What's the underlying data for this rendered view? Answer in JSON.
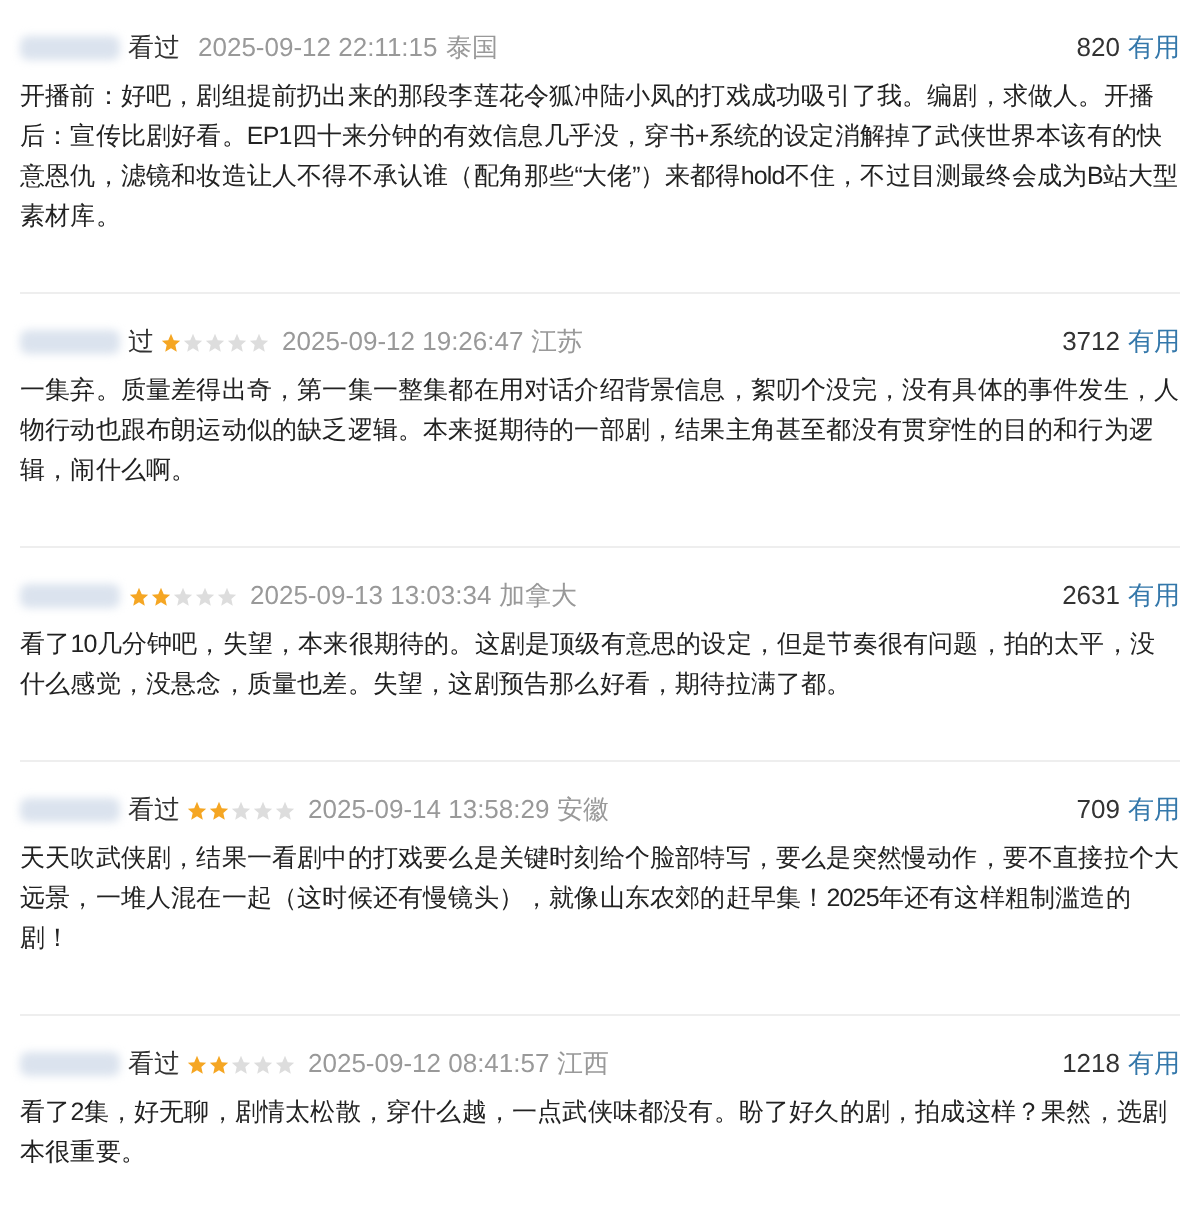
{
  "reviews": [
    {
      "status": "看过",
      "time": "2025-09-12 22:11:15",
      "location": "泰国",
      "votes": "820",
      "vote_label": "有用",
      "text": "开播前：好吧，剧组提前扔出来的那段李莲花令狐冲陆小凤的打戏成功吸引了我。编剧，求做人。开播后：宣传比剧好看。EP1四十来分钟的有效信息几乎没，穿书+系统的设定消解掉了武侠世界本该有的快意恩仇，滤镜和妆造让人不得不承认谁（配角那些“大佬”）来都得hold不住，不过目测最终会成为B站大型素材库。"
    },
    {
      "status": "过",
      "stars": 1,
      "time": "2025-09-12 19:26:47",
      "location": "江苏",
      "votes": "3712",
      "vote_label": "有用",
      "text": "一集弃。质量差得出奇，第一集一整集都在用对话介绍背景信息，絮叨个没完，没有具体的事件发生，人物行动也跟布朗运动似的缺乏逻辑。本来挺期待的一部剧，结果主角甚至都没有贯穿性的目的和行为逻辑，闹什么啊。"
    },
    {
      "stars": 2,
      "time": "2025-09-13 13:03:34",
      "location": "加拿大",
      "votes": "2631",
      "vote_label": "有用",
      "text": "看了10几分钟吧，失望，本来很期待的。这剧是顶级有意思的设定，但是节奏很有问题，拍的太平，没什么感觉，没悬念，质量也差。失望，这剧预告那么好看，期待拉满了都。"
    },
    {
      "status": "看过",
      "stars": 2,
      "time": "2025-09-14 13:58:29",
      "location": "安徽",
      "votes": "709",
      "vote_label": "有用",
      "text": "天天吹武侠剧，结果一看剧中的打戏要么是关键时刻给个脸部特写，要么是突然慢动作，要不直接拉个大远景，一堆人混在一起（这时候还有慢镜头），就像山东农郊的赶早集！2025年还有这样粗制滥造的剧！"
    },
    {
      "status": "看过",
      "stars": 2,
      "time": "2025-09-12 08:41:57",
      "location": "江西",
      "votes": "1218",
      "vote_label": "有用",
      "text": "看了2集，好无聊，剧情太松散，穿什么越，一点武侠味都没有。盼了好久的剧，拍成这样？果然，选剧本很重要。"
    }
  ]
}
